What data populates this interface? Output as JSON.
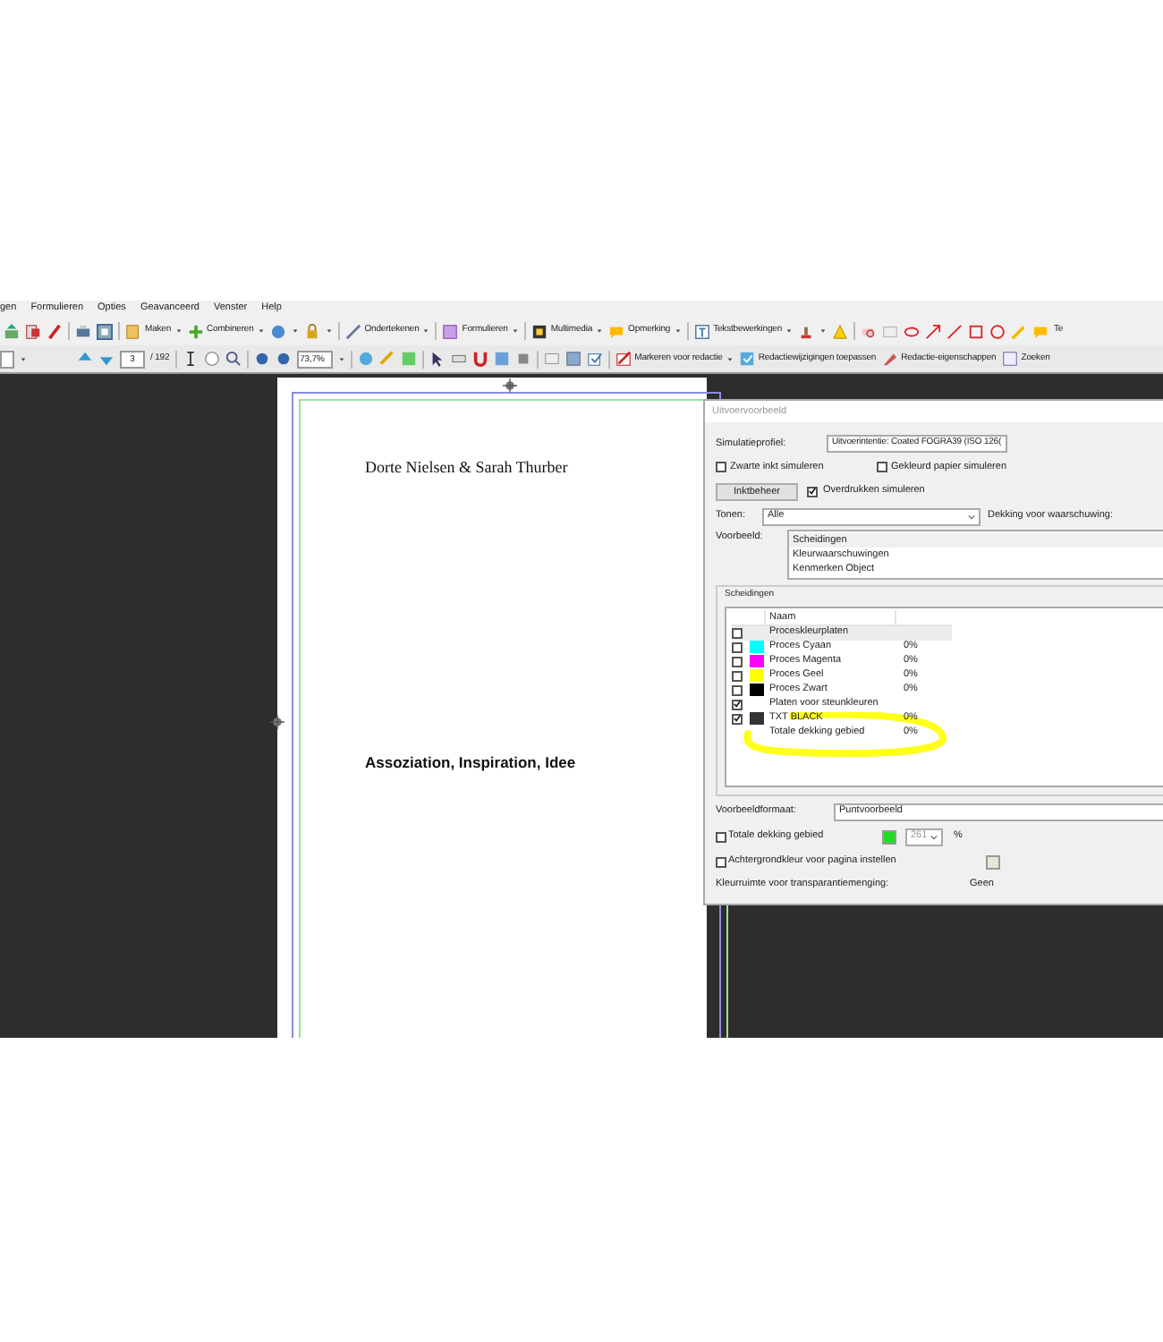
{
  "menu_bar": [
    "gen",
    "Formulieren",
    "Opties",
    "Geavanceerd",
    "Venster",
    "Help"
  ],
  "toolbar_1": {
    "buttons": [
      "Maken",
      "Combineren",
      "Ondertekenen",
      "Formulieren",
      "Multimedia",
      "Opmerking",
      "Tekstbewerkingen"
    ],
    "cut_label": "Te"
  },
  "toolbar_2": {
    "page": "3",
    "page_count": "/ 192",
    "zoom": "73,7%",
    "buttons": [
      "Markeren voor redactie",
      "Redactiewijzigingen toepassen",
      "Redactie-eigenschappen",
      "Zoeken"
    ]
  },
  "document": {
    "authors": "Dorte Nielsen & Sarah Thurber",
    "heading": "Assoziation, Inspiration, Idee"
  },
  "dialog": {
    "title": "Uitvoervoorbeeld",
    "simulation_profile": {
      "label": "Simulatieprofiel:",
      "value": "Uitvoerintentie: Coated FOGRA39 (ISO 126("
    },
    "options": [
      {
        "label": "Zwarte inkt simuleren",
        "checked": false
      },
      {
        "label": "Gekleurd papier simuleren",
        "checked": false
      }
    ],
    "ink_button": "Inktbeheer",
    "overprint": {
      "label": "Overdrukken simuleren",
      "checked": true
    },
    "show": {
      "label": "Tonen:",
      "value": "Alle"
    },
    "warning_label": "Dekking voor waarschuwing:",
    "preview": {
      "label": "Voorbeeld:",
      "items": [
        {
          "label": "Scheidingen",
          "selected": true
        },
        {
          "label": "Kleurwaarschuwingen",
          "selected": false
        },
        {
          "label": "Kenmerken Object",
          "selected": false
        }
      ]
    },
    "separations": {
      "label": "Scheidingen",
      "column": "Naam",
      "rows": [
        {
          "kind": "group",
          "checked": false,
          "name": "Proceskleurplaten"
        },
        {
          "kind": "ink",
          "checked": false,
          "color": "#00ffff",
          "name": "Proces Cyaan",
          "value": "0%"
        },
        {
          "kind": "ink",
          "checked": false,
          "color": "#ff00ff",
          "name": "Proces Magenta",
          "value": "0%"
        },
        {
          "kind": "ink",
          "checked": false,
          "color": "#ffff00",
          "name": "Proces Geel",
          "value": "0%"
        },
        {
          "kind": "ink",
          "checked": false,
          "color": "#000000",
          "name": "Proces Zwart",
          "value": "0%"
        },
        {
          "kind": "group",
          "checked": true,
          "name": "Platen voor steunkleuren"
        },
        {
          "kind": "ink",
          "checked": true,
          "color": "#333333",
          "name": "TXT BLACK",
          "value": "0%"
        },
        {
          "kind": "total",
          "name": "Totale dekking gebied",
          "value": "0%"
        }
      ]
    },
    "preview_format": {
      "label": "Voorbeeldformaat:",
      "value": "Puntvoorbeeld"
    },
    "total_coverage": {
      "label": "Totale dekking gebied",
      "checked": false,
      "color": "#22dd22",
      "value": "261",
      "value_disabled": true,
      "unit": "%"
    },
    "background": {
      "label": "Achtergrondkleur voor pagina instellen",
      "checked": false,
      "color": "#e8e4d8"
    },
    "blend_space": {
      "label": "Kleurruimte voor transparantiemenging:",
      "value": "Geen"
    }
  }
}
